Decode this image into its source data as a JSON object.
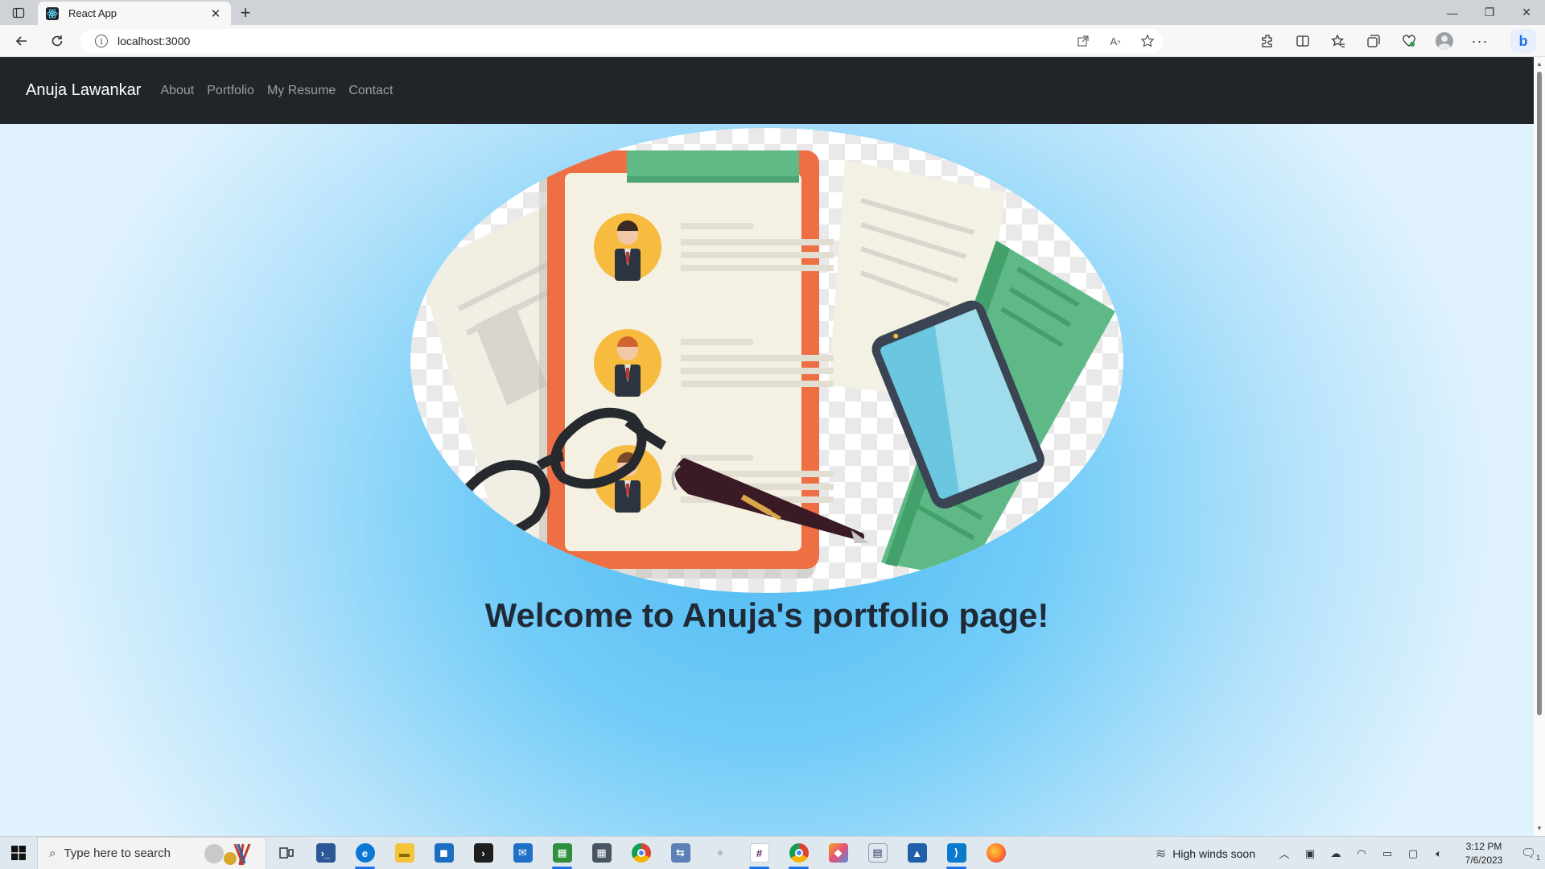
{
  "browser": {
    "tab_title": "React App",
    "tab_close": "✕",
    "new_tab": "+",
    "url": "localhost:3000",
    "window_controls": {
      "minimize": "—",
      "restore": "❐",
      "close": "✕"
    }
  },
  "navbar": {
    "brand": "Anuja Lawankar",
    "links": [
      "About",
      "Portfolio",
      "My Resume",
      "Contact"
    ]
  },
  "main": {
    "welcome": "Welcome to Anuja's portfolio page!",
    "hero_image_alt_icon": "resume-clipboard-illustration-icon"
  },
  "taskbar": {
    "search_placeholder": "Type here to search",
    "weather_text": "High winds soon",
    "time": "3:12 PM",
    "date": "7/6/2023",
    "notification_count": "1",
    "apps": [
      "task-view",
      "powershell",
      "edge",
      "file-explorer",
      "store",
      "terminal",
      "mail",
      "sheets",
      "calculator",
      "chrome",
      "remote",
      "dot",
      "slack",
      "chrome-profile",
      "prism",
      "notes",
      "photos",
      "vscode",
      "firefox"
    ]
  },
  "colors": {
    "navbar": "#212529",
    "page_bg_center": "#4fb9f3",
    "clipboard_frame": "#ee6f44",
    "clip_green": "#5fba86",
    "avatar_circle": "#f6bb3f",
    "phone_screen": "#6bc7e0"
  }
}
